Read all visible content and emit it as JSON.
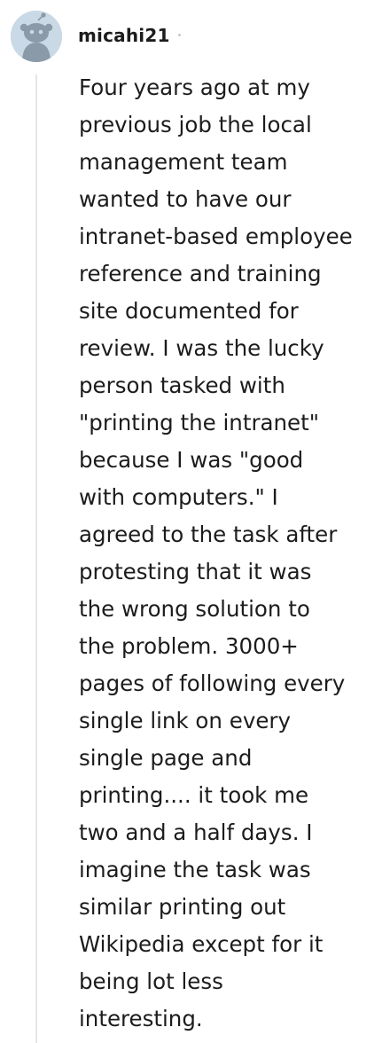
{
  "comment": {
    "author": "micahi21",
    "avatar_icon": "reddit-snoo-avatar-icon",
    "body": "Four years ago at my\nprevious job the local\nmanagement team\nwanted to have our\nintranet-based employee\nreference and training\nsite documented for\nreview. I was the lucky\nperson tasked with\n\"printing the intranet\"\nbecause I was \"good\nwith computers.\" I\nagreed to the task after\nprotesting that it was\nthe wrong solution to\nthe problem. 3000+\npages of following every\nsingle link on every\nsingle page and\nprinting.... it took me\ntwo and a half days. I\nimagine the task was\nsimilar printing out\nWikipedia except for it\nbeing lot less\ninteresting."
  },
  "colors": {
    "text": "#1c1c1c",
    "avatar_bg": "#c9d9e6",
    "snoo_body": "#8a9aa8",
    "thread_line": "#e6e6e6"
  }
}
